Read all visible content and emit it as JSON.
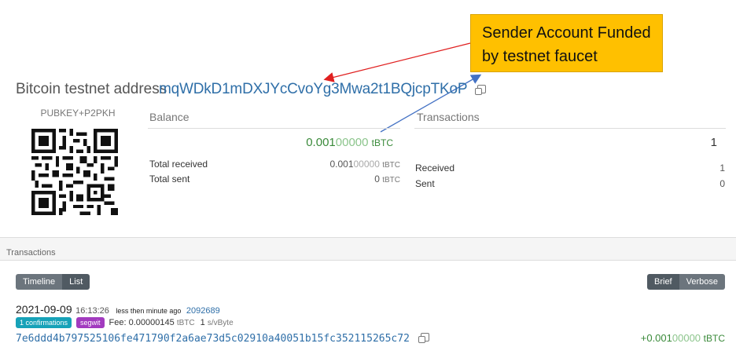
{
  "callout": {
    "line1": "Sender Account Funded",
    "line2": "by testnet faucet"
  },
  "header": {
    "label": "Bitcoin testnet address",
    "address": "mqWDkD1mDXJYcCvoYg3Mwa2t1BQjcpTKoP",
    "address_type": "PUBKEY+P2PKH",
    "copy_icon": "copy-icon",
    "qr_icon": "qr-code"
  },
  "balance": {
    "title": "Balance",
    "amount_main": "0.001",
    "amount_faint": "00000",
    "unit": "tBTC",
    "total_received_label": "Total received",
    "total_received_main": "0.001",
    "total_received_faint": "00000",
    "total_received_unit": "tBTC",
    "total_sent_label": "Total sent",
    "total_sent_value": "0",
    "total_sent_unit": "tBTC"
  },
  "transactions_summary": {
    "title": "Transactions",
    "count": "1",
    "received_label": "Received",
    "received_value": "1",
    "sent_label": "Sent",
    "sent_value": "0"
  },
  "tx_section": {
    "label": "Transactions",
    "view_buttons": [
      "Timeline",
      "List"
    ],
    "active_view": "List",
    "detail_buttons": [
      "Brief",
      "Verbose"
    ],
    "active_detail": "Brief"
  },
  "tx": {
    "date": "2021-09-09",
    "time": "16:13:26",
    "ago": "less then minute ago",
    "block": "2092689",
    "confirmations": "1 confirmations",
    "segwit": "segwit",
    "fee_label": "Fee:",
    "fee_value": "0.00000145",
    "fee_unit": "tBTC",
    "rate_value": "1",
    "rate_unit": "s/vByte",
    "txid": "7e6ddd4b797525106fe471790f2a6ae73d5c02910a40051b15fc352115265c72",
    "amount_prefix": "+0.001",
    "amount_faint": "00000",
    "amount_unit": "tBTC"
  },
  "colors": {
    "callout_bg": "#ffc000",
    "link": "#2f6fa8",
    "amount_green": "#3a8a3a",
    "arrow_red": "#e02020",
    "arrow_blue": "#4472c4",
    "badge_conf": "#17a2b8",
    "badge_segwit": "#a23bbf"
  }
}
